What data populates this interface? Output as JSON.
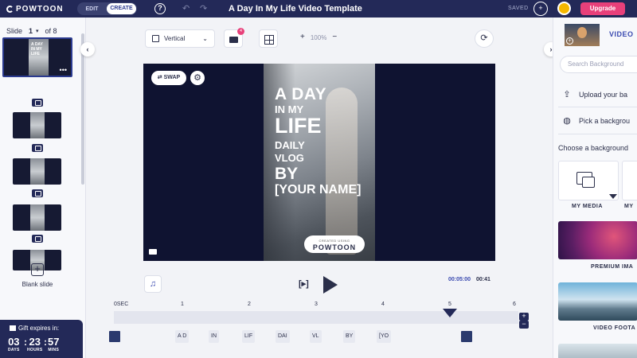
{
  "topbar": {
    "logo": "POWTOON",
    "mode_edit": "EDIT",
    "mode_create": "CREATE",
    "help": "?",
    "title": "A Day In My Life Video Template",
    "saved": "SAVED",
    "upgrade": "Upgrade"
  },
  "slides": {
    "label": "Slide",
    "current": "1",
    "of": "of 8",
    "thumb1_text": "A DAY IN MY LIFE",
    "blank": "Blank slide"
  },
  "gift": {
    "label": "Gift expires in:",
    "days": "03",
    "days_label": "DAYS",
    "hours": "23",
    "hours_label": "HOURS",
    "mins": "57",
    "mins_label": "MINS"
  },
  "toolbar": {
    "orientation": "Vertical",
    "camera_badge": "4",
    "zoom": "100%",
    "zoom_in": "+",
    "zoom_out": "−"
  },
  "canvas": {
    "swap": "SWAP",
    "lines": [
      "A DAY",
      "IN MY",
      "LIFE",
      "DAILY",
      "VLOG",
      "BY",
      "[YOUR NAME]"
    ],
    "badge_top": "CREATED USING",
    "badge_brand": "POWTOON"
  },
  "playback": {
    "current": "00:05:00",
    "total": "00:41"
  },
  "timeline": {
    "ticks": [
      "0SEC",
      "1",
      "2",
      "3",
      "4",
      "5",
      "6"
    ],
    "chips": [
      "A D",
      "IN",
      "LIF",
      "DAI",
      "VL",
      "BY",
      "[YO"
    ],
    "playhead_sec": 5
  },
  "right": {
    "header": "VIDEO",
    "search_placeholder": "Search Background",
    "upload": "Upload your ba",
    "pick": "Pick a backgrou",
    "choose": "Choose a background",
    "my_media": "MY MEDIA",
    "my_media_2": "MY",
    "premium": "PREMIUM IMA",
    "video_footage": "VIDEO FOOTA"
  }
}
